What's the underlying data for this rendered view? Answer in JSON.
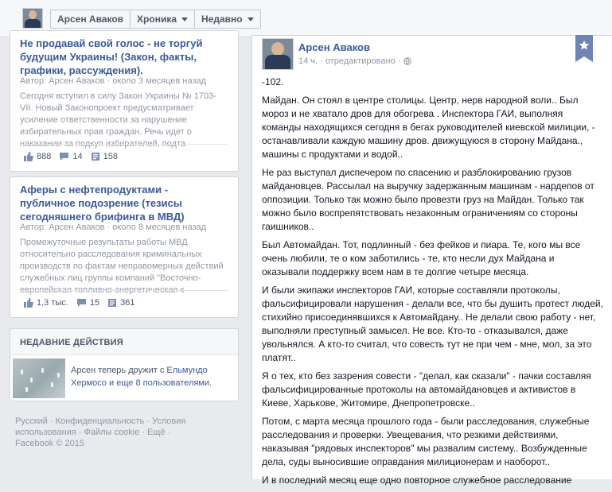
{
  "topbar": {
    "crumbs": [
      {
        "label": "Арсен Аваков",
        "has_caret": false
      },
      {
        "label": "Хроника",
        "has_caret": true
      },
      {
        "label": "Недавно",
        "has_caret": true
      }
    ]
  },
  "cards": [
    {
      "title": "Не продавай свой голос - не торгуй будущим Украины! (Закон, факты, графики, рассуждения).",
      "meta": "Автор: Арсен Аваков · около 3 месяцев назад",
      "text": "Сегодня вступил в силу Закон Украины № 1703-VII. Новый Законопроект предусматривает усиление ответственности за нарушение избирательных прав граждан. Речь идет о наказании за подкуп избирателей, подта",
      "likes": "888",
      "comments": "14",
      "shares": "158"
    },
    {
      "title": "Аферы с нефтепродуктами - публичное подозрение (тезисы сегодняшнего брифинга в МВД)",
      "meta": "Автор: Арсен Аваков · около 8 месяцев назад",
      "text": "Промежуточные результаты работы МВД относительно расследования криминальных производств по фактам неправомерных действий служебных лиц группы компаний \"Восточно-европейская топливно-энергетическая к",
      "likes": "1,3 тыс.",
      "comments": "15",
      "shares": "361"
    }
  ],
  "recent": {
    "title": "НЕДАВНИЕ ДЕЙСТВИЯ",
    "text_before": "Арсен теперь дружит с ",
    "friend": "Ельмундо Хермосо",
    "text_mid": " и ",
    "others": "еще 8 пользователями",
    "text_after": "."
  },
  "footer": "Русский · Конфиденциальность · Условия использования · Файлы cookie · Ещё · Facebook © 2015",
  "post": {
    "author": "Арсен Аваков",
    "meta": "14 ч. · отредактировано ·",
    "paragraphs": [
      "-102.",
      "Майдан. Он стоял в центре столицы. Центр, нерв народной воли.. Был мороз и не хватало дров для обогрева . Инспектора ГАИ, выполняя команды находящихся сегодня в бегах руководителей киевской милиции, - останавливали каждую машину дров. движущуюся в сторону Майдана., машины с продуктами и водой..",
      "Не раз выступал диспечером по спасению и разблокированию грузов майдановцев. Рассылал на выручку задержанным машинам - нардепов от оппозиции. Только так можно было провезти груз на Майдан. Только так можно было воспрепятствовать незаконным ограничениям со стороны гаишников..",
      "Был Автомайдан. Тот, подлинный - без фейков и пиара. Те, кого мы все очень любили, те о ком заботились - те, кто несли дух Майдана и оказывали поддержку всем нам в те долгие четыре месяца.",
      "И были экипажи инспекторов ГАИ, которые составляли протоколы, фальсифицировали нарушения - делали все, что бы душить протест людей, стихийно присоединявшихся к Автомайдану.. Не делали свою работу - нет, выполняли преступный замысел. Не все. Кто-то - отказывался, даже увольнялся. А кто-то считал, что совесть тут не при чем - мне, мол, за это платят..",
      "Я о тех, кто без зазрения совести - \"делал, как сказали\" - пачки составляя фальсифицированные протоколы на автомайдановцев и активистов в Киеве, Харькове, Житомире, Днепропетровске..",
      "Потом, с марта месяца прошлого года - были расследования, служебные расследования и проверки. Увещевания, что резкими действиями, наказывая \"рядовых инспекторов\" мы развалим систему.. Возбужденные дела, суды выносившие оправдания милиционерам и наоборот..",
      "И в последний месяц еще одно повторное служебное расследование"
    ]
  },
  "colors": {
    "link": "#3b5998",
    "background": "#e9eaed",
    "muted": "#9197a3"
  },
  "icons": [
    "like-icon",
    "comment-icon",
    "share-icon",
    "globe-icon",
    "caret-down-icon",
    "star-ribbon-icon"
  ]
}
